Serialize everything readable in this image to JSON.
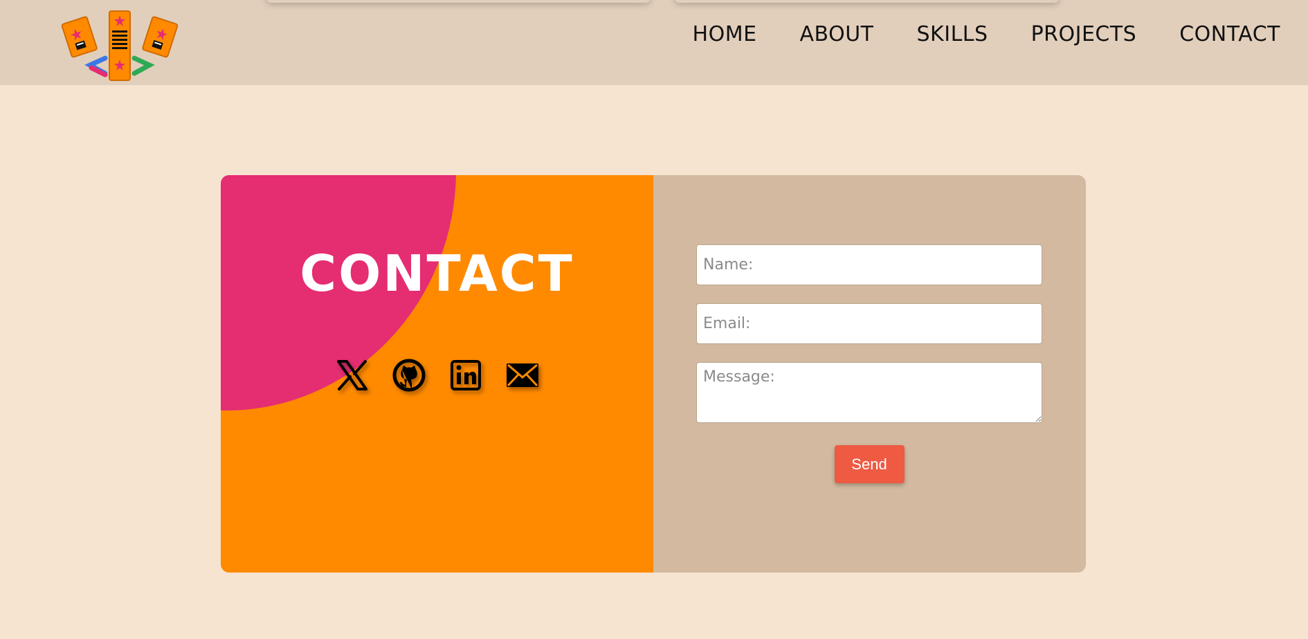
{
  "header": {
    "logo_alt": "logo",
    "nav": [
      {
        "label": "HOME"
      },
      {
        "label": "ABOUT"
      },
      {
        "label": "SKILLS"
      },
      {
        "label": "PROJECTS"
      },
      {
        "label": "CONTACT"
      }
    ]
  },
  "contact": {
    "title": "CONTACT",
    "socials": [
      {
        "icon": "x-twitter-icon"
      },
      {
        "icon": "github-icon"
      },
      {
        "icon": "linkedin-icon"
      },
      {
        "icon": "mail-icon"
      }
    ],
    "form": {
      "name_placeholder": "Name:",
      "email_placeholder": "Email:",
      "message_placeholder": "Message:",
      "send_label": "Send"
    }
  },
  "colors": {
    "background": "#f6e3d0",
    "header": "#e2cfbb",
    "card_orange": "#ff8a00",
    "card_pink": "#e52d72",
    "form_panel": "#d2b99f",
    "send_button": "#ee5a42"
  }
}
